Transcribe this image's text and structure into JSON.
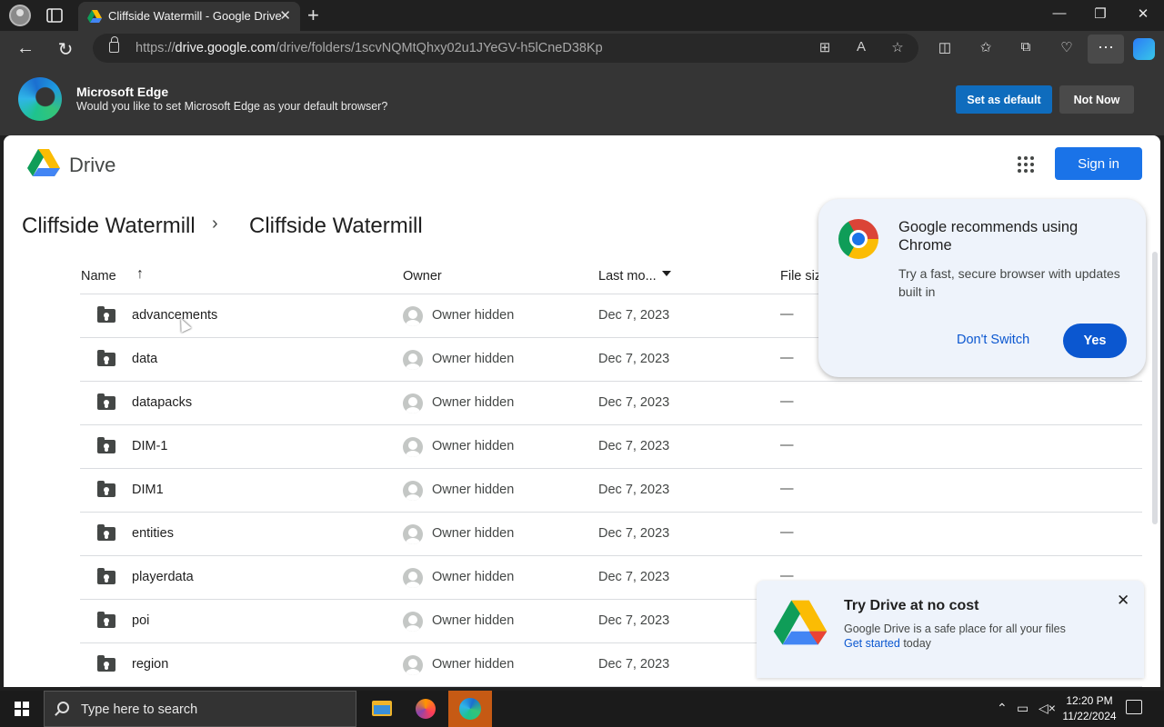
{
  "browser": {
    "tab_title": "Cliffside Watermill - Google Drive",
    "new_tab_icon": "+",
    "url_prefix": "https://",
    "url_domain": "drive.google.com",
    "url_path": "/drive/folders/1scvNQMtQhxy02u1JYeGV-h5lCneD38Kp"
  },
  "banner": {
    "title": "Microsoft Edge",
    "message": "Would you like to set Microsoft Edge as your default browser?",
    "set_default_label": "Set as default",
    "not_now_label": "Not Now"
  },
  "drive": {
    "app_name": "Drive",
    "sign_in_label": "Sign in",
    "breadcrumb": [
      "Cliffside Watermill",
      "Cliffside Watermill"
    ],
    "columns": {
      "name": "Name",
      "owner": "Owner",
      "modified": "Last mo...",
      "size": "File siz"
    },
    "rows": [
      {
        "name": "advancements",
        "owner": "Owner hidden",
        "modified": "Dec 7, 2023",
        "size": "—"
      },
      {
        "name": "data",
        "owner": "Owner hidden",
        "modified": "Dec 7, 2023",
        "size": "—"
      },
      {
        "name": "datapacks",
        "owner": "Owner hidden",
        "modified": "Dec 7, 2023",
        "size": "—"
      },
      {
        "name": "DIM-1",
        "owner": "Owner hidden",
        "modified": "Dec 7, 2023",
        "size": "—"
      },
      {
        "name": "DIM1",
        "owner": "Owner hidden",
        "modified": "Dec 7, 2023",
        "size": "—"
      },
      {
        "name": "entities",
        "owner": "Owner hidden",
        "modified": "Dec 7, 2023",
        "size": "—"
      },
      {
        "name": "playerdata",
        "owner": "Owner hidden",
        "modified": "Dec 7, 2023",
        "size": "—"
      },
      {
        "name": "poi",
        "owner": "Owner hidden",
        "modified": "Dec 7, 2023",
        "size": ""
      },
      {
        "name": "region",
        "owner": "Owner hidden",
        "modified": "Dec 7, 2023",
        "size": ""
      }
    ]
  },
  "chrome_popup": {
    "title": "Google recommends using Chrome",
    "body": "Try a fast, secure browser with updates built in",
    "dont_switch_label": "Don't Switch",
    "yes_label": "Yes"
  },
  "try_drive": {
    "title": "Try Drive at no cost",
    "body": "Google Drive is a safe place for all your files",
    "link_label": "Get started",
    "link_suffix": " today"
  },
  "taskbar": {
    "search_placeholder": "Type here to search",
    "time": "12:20 PM",
    "date": "11/22/2024"
  },
  "colors": {
    "drive_blue": "#1a73e8",
    "edge_blue": "#0f6cbd",
    "popup_bg": "#eef3fb"
  }
}
